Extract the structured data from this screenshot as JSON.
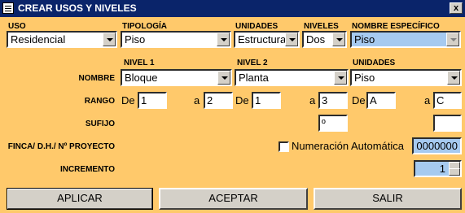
{
  "window": {
    "title": "CREAR USOS Y NIVELES",
    "close_label": "x"
  },
  "top_headers": {
    "uso": "USO",
    "tipologia": "TIPOLOGÍA",
    "unidades": "UNIDADES",
    "niveles": "NIVELES",
    "nombre_especifico": "NOMBRE ESPECÍFICO"
  },
  "top_values": {
    "uso": "Residencial",
    "tipologia": "Piso",
    "unidades": "Estructura",
    "niveles": "Dos",
    "nombre_especifico": "Piso"
  },
  "level_headers": {
    "nivel1": "NIVEL 1",
    "nivel2": "NIVEL 2",
    "unidades": "UNIDADES"
  },
  "row_labels": {
    "nombre": "NOMBRE",
    "rango": "RANGO",
    "sufijo": "SUFIJO",
    "finca": "FINCA/ D.H./ Nº PROYECTO",
    "incremento": "INCREMENTO"
  },
  "nombre_values": {
    "nivel1": "Bloque",
    "nivel2": "Planta",
    "unidades": "Piso"
  },
  "rango": {
    "de_label": "De",
    "a_label": "a",
    "nivel1_from": "1",
    "nivel1_to": "2",
    "nivel2_from": "1",
    "nivel2_to": "3",
    "unidades_from": "A",
    "unidades_to": "C"
  },
  "sufijo": {
    "nivel2": "º",
    "unidades": ""
  },
  "numeracion": {
    "label": "Numeración Automática",
    "checked": false,
    "value": "0000000"
  },
  "incremento": {
    "value": "1"
  },
  "buttons": {
    "aplicar": "APLICAR",
    "aceptar": "ACEPTAR",
    "salir": "SALIR"
  }
}
